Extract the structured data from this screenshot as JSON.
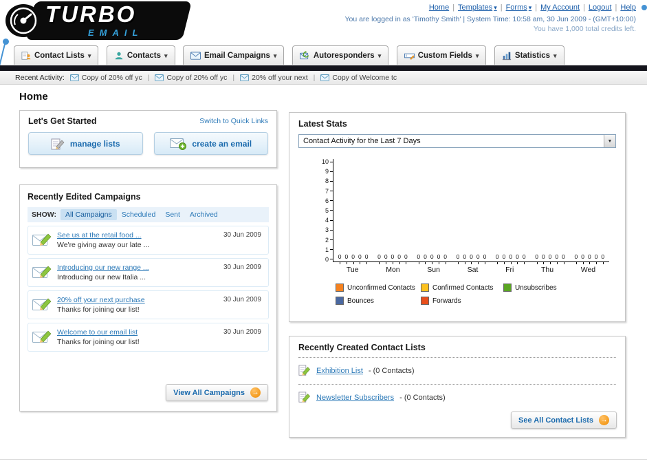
{
  "logo": {
    "title": "TURBO",
    "subtitle": "EMAIL"
  },
  "header": {
    "top_links": [
      "Home",
      "Templates",
      "Forms",
      "My Account",
      "Logout",
      "Help"
    ],
    "login_status": "You are logged in as 'Timothy Smith' | System Time: 10:58 am, 30 Jun 2009 - (GMT+10:00)",
    "credits": "You have 1,000 total credits left."
  },
  "nav": {
    "tabs": [
      {
        "label": "Contact Lists"
      },
      {
        "label": "Contacts"
      },
      {
        "label": "Email Campaigns"
      },
      {
        "label": "Autoresponders"
      },
      {
        "label": "Custom Fields"
      },
      {
        "label": "Statistics"
      }
    ]
  },
  "recent_activity": {
    "label": "Recent Activity:",
    "items": [
      "Copy of 20% off yc",
      "Copy of 20% off yc",
      "20% off your next",
      "Copy of Welcome tc"
    ]
  },
  "page_title": "Home",
  "get_started": {
    "title": "Let's Get Started",
    "switch_link": "Switch to Quick Links",
    "buttons": [
      {
        "label": "manage lists"
      },
      {
        "label": "create an email"
      }
    ]
  },
  "campaigns": {
    "title": "Recently Edited Campaigns",
    "show_label": "SHOW:",
    "filters": [
      "All Campaigns",
      "Scheduled",
      "Sent",
      "Archived"
    ],
    "active_filter": "All Campaigns",
    "items": [
      {
        "title": "See us at the retail food ...",
        "subtitle": "We're giving away our late ...",
        "date": "30 Jun 2009"
      },
      {
        "title": "Introducing our new range ...",
        "subtitle": "Introducing our new Italia ...",
        "date": "30 Jun 2009"
      },
      {
        "title": "20% off your next purchase",
        "subtitle": "Thanks for joining our list!",
        "date": "30 Jun 2009"
      },
      {
        "title": "Welcome to our email list",
        "subtitle": "Thanks for joining our list!",
        "date": "30 Jun 2009"
      }
    ],
    "view_all_label": "View All Campaigns"
  },
  "stats": {
    "title": "Latest Stats",
    "dropdown_value": "Contact Activity for the Last 7 Days",
    "legend": [
      {
        "label": "Unconfirmed Contacts",
        "color": "#f58220"
      },
      {
        "label": "Confirmed Contacts",
        "color": "#fcc11e"
      },
      {
        "label": "Unsubscribes",
        "color": "#5aa522"
      },
      {
        "label": "Bounces",
        "color": "#4a68a0"
      },
      {
        "label": "Forwards",
        "color": "#e84e1b"
      }
    ]
  },
  "chart_data": {
    "type": "bar",
    "title": "Contact Activity for the Last 7 Days",
    "categories": [
      "Tue",
      "Mon",
      "Sun",
      "Sat",
      "Fri",
      "Thu",
      "Wed"
    ],
    "series": [
      {
        "name": "Unconfirmed Contacts",
        "values": [
          0,
          0,
          0,
          0,
          0,
          0,
          0
        ]
      },
      {
        "name": "Confirmed Contacts",
        "values": [
          0,
          0,
          0,
          0,
          0,
          0,
          0
        ]
      },
      {
        "name": "Unsubscribes",
        "values": [
          0,
          0,
          0,
          0,
          0,
          0,
          0
        ]
      },
      {
        "name": "Bounces",
        "values": [
          0,
          0,
          0,
          0,
          0,
          0,
          0
        ]
      },
      {
        "name": "Forwards",
        "values": [
          0,
          0,
          0,
          0,
          0,
          0,
          0
        ]
      }
    ],
    "xlabel": "",
    "ylabel": "",
    "ylim": [
      0,
      10
    ],
    "yticks": [
      0,
      1,
      2,
      3,
      4,
      5,
      6,
      7,
      8,
      9,
      10
    ],
    "grid": false,
    "legend_position": "bottom"
  },
  "contact_lists": {
    "title": "Recently Created Contact Lists",
    "items": [
      {
        "name": "Exhibition List",
        "suffix": "- (0 Contacts)"
      },
      {
        "name": "Newsletter Subscribers",
        "suffix": "- (0 Contacts)"
      }
    ],
    "see_all_label": "See All Contact Lists"
  },
  "colors": {
    "link_blue": "#1b5eaa",
    "button_text_blue": "#1a6aad",
    "accent_orange": "#ef8b00",
    "dark_bar": "#14141c"
  }
}
